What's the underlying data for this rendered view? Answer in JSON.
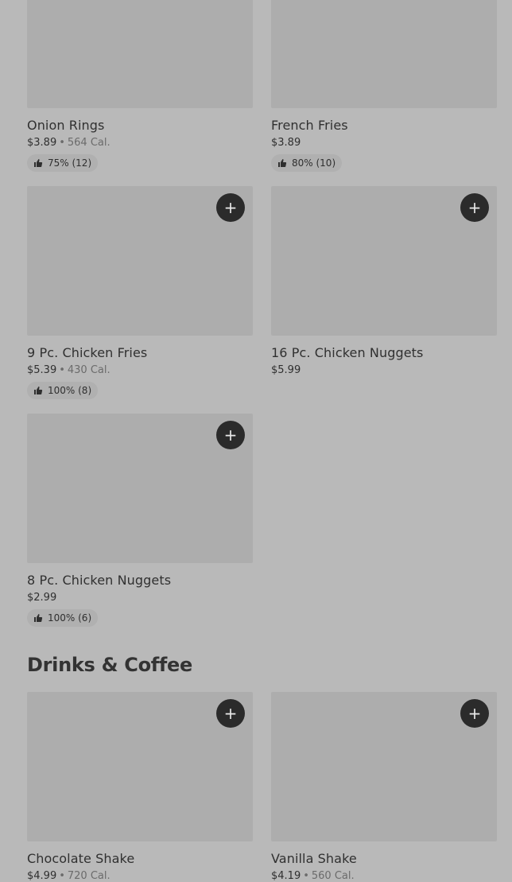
{
  "rows": [
    {
      "left": {
        "name": "Onion Rings",
        "price": "$3.89",
        "calories": "564 Cal.",
        "rating": "75% (12)"
      },
      "right": {
        "name": "French Fries",
        "price": "$3.89",
        "calories": "",
        "rating": "80% (10)"
      }
    },
    {
      "left": {
        "name": "9 Pc. Chicken Fries",
        "price": "$5.39",
        "calories": "430 Cal.",
        "rating": "100% (8)"
      },
      "right": {
        "name": "16 Pc. Chicken Nuggets",
        "price": "$5.99",
        "calories": "",
        "rating": ""
      }
    },
    {
      "left": {
        "name": "8 Pc. Chicken Nuggets",
        "price": "$2.99",
        "calories": "",
        "rating": "100% (6)"
      }
    }
  ],
  "section": {
    "title": "Drinks & Coffee"
  },
  "drinks": {
    "left": {
      "name": "Chocolate Shake",
      "price": "$4.99",
      "calories": "720 Cal."
    },
    "right": {
      "name": "Vanilla Shake",
      "price": "$4.19",
      "calories": "560 Cal."
    }
  },
  "icons": {
    "add": "plus-icon",
    "rating": "thumbs-up-icon"
  },
  "add_symbol": "+",
  "separator": "•"
}
